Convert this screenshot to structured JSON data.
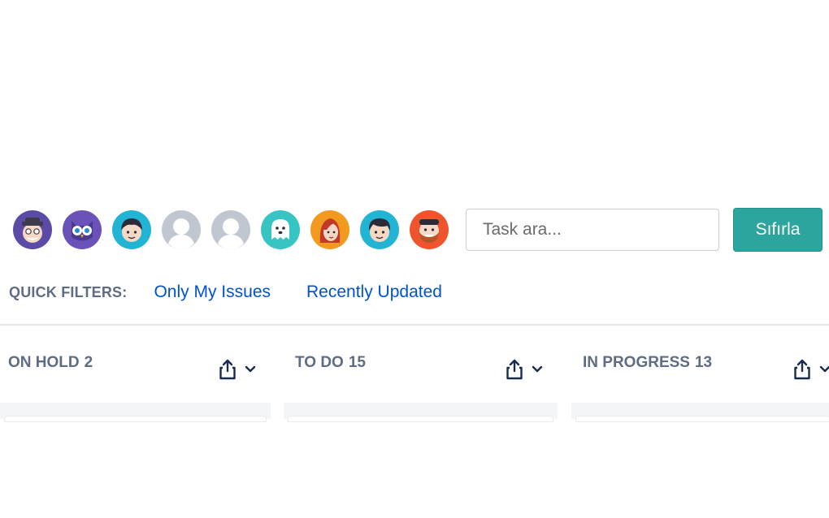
{
  "toolbar": {
    "avatars": [
      {
        "name": "avatar-sheriff",
        "bg": "#5b4aa6"
      },
      {
        "name": "avatar-owl",
        "bg": "#6a52b8"
      },
      {
        "name": "avatar-boy",
        "bg": "#21b4d4"
      },
      {
        "name": "avatar-default",
        "bg": "#c1c7d0"
      },
      {
        "name": "avatar-default",
        "bg": "#c1c7d0"
      },
      {
        "name": "avatar-ghost",
        "bg": "#36c5c2"
      },
      {
        "name": "avatar-redhead",
        "bg": "#f29a1f"
      },
      {
        "name": "avatar-man",
        "bg": "#21b4d4"
      },
      {
        "name": "avatar-beard",
        "bg": "#f0542c"
      }
    ],
    "search": {
      "placeholder": "Task ara...",
      "value": ""
    },
    "reset_label": "Sıfırla"
  },
  "quick_filters": {
    "label": "QUICK FILTERS:",
    "items": [
      "Only My Issues",
      "Recently Updated"
    ]
  },
  "columns": [
    {
      "title": "ON HOLD",
      "count": "2",
      "icons": [
        "share-icon",
        "chevron-down-icon"
      ]
    },
    {
      "title": "TO DO",
      "count": "15",
      "icons": [
        "share-icon",
        "chevron-down-icon"
      ]
    },
    {
      "title": "IN PROGRESS",
      "count": "13",
      "icons": [
        "share-icon",
        "chevron-down-icon"
      ]
    }
  ],
  "colors": {
    "accent": "#2ca59e",
    "link": "#0052cc",
    "muted": "#5e6c84",
    "column_bg": "#f4f5f7"
  }
}
